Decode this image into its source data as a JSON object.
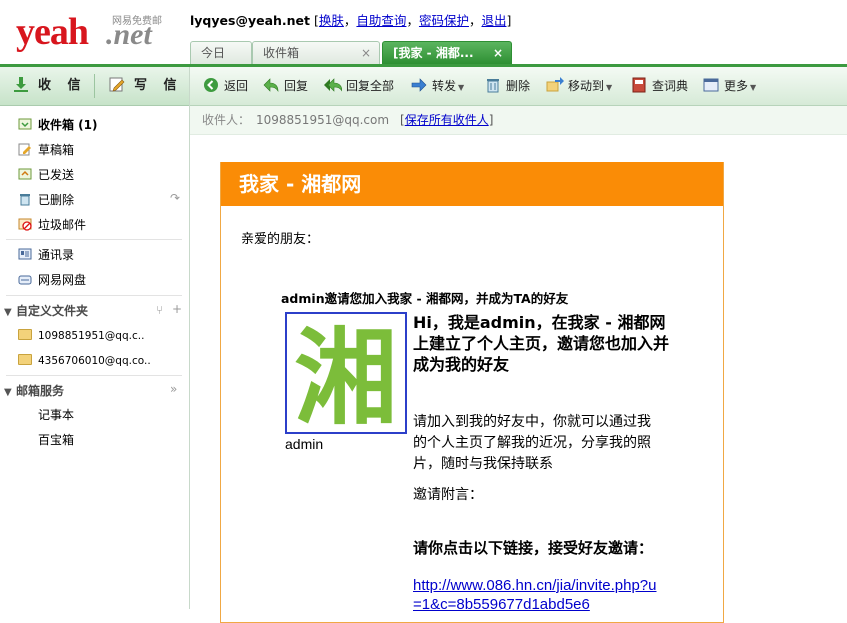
{
  "header": {
    "logo_main": "yeah",
    "logo_suffix": ".net",
    "logo_tag": "网易免费邮",
    "user": "lyqyes@yeah.net",
    "links": [
      "换肤",
      "自助查询",
      "密码保护",
      "退出"
    ]
  },
  "tabs": [
    {
      "label": "今日",
      "closable": false
    },
    {
      "label": "收件箱",
      "closable": true
    },
    {
      "label": "[我家 - 湘都...",
      "closable": true,
      "active": true
    }
  ],
  "sidebar": {
    "receive_label": "收 信",
    "write_label": "写 信",
    "folders": [
      {
        "label": "收件箱 (1)",
        "icon": "inbox-icon",
        "bold": true
      },
      {
        "label": "草稿箱",
        "icon": "drafts-icon"
      },
      {
        "label": "已发送",
        "icon": "sent-icon"
      },
      {
        "label": "已删除",
        "icon": "trash-icon"
      },
      {
        "label": "垃圾邮件",
        "icon": "spam-icon"
      }
    ],
    "tools": [
      {
        "label": "通讯录",
        "icon": "contacts-icon"
      },
      {
        "label": "网易网盘",
        "icon": "netdisk-icon"
      }
    ],
    "custom_section": "自定义文件夹",
    "custom_folders": [
      "1098851951@qq.c..",
      "4356706010@qq.co.."
    ],
    "service_section": "邮箱服务",
    "services": [
      "记事本",
      "百宝箱"
    ]
  },
  "toolbar": {
    "back": "返回",
    "reply": "回复",
    "reply_all": "回复全部",
    "forward": "转发",
    "delete": "删除",
    "move_to": "移动到",
    "dictionary": "查词典",
    "more": "更多"
  },
  "recipient": {
    "label": "收件人：",
    "address": "1098851951@qq.com",
    "save_all": "保存所有收件人"
  },
  "mail": {
    "header": "我家 - 湘都网",
    "greeting": "亲爱的朋友：",
    "invite_title": "admin邀请您加入我家 - 湘都网，并成为TA的好友",
    "avatar_char": "湘",
    "avatar_name": "admin",
    "hi_text": "Hi，我是admin，在我家 - 湘都网上建立了个人主页，邀请您也加入并成为我的好友",
    "invite_text": "请加入到我的好友中，你就可以通过我的个人主页了解我的近况，分享我的照片，随时与我保持联系",
    "message_label": "邀请附言：",
    "link_prompt": "请你点击以下链接，接受好友邀请：",
    "link": "http://www.086.hn.cn/jia/invite.php?u=1&c=8b559677d1abd5e6"
  },
  "colors": {
    "brand_red": "#d8161e",
    "accent_green": "#3c9a40",
    "mail_orange": "#fa8c06",
    "link_blue": "#0000cc"
  }
}
